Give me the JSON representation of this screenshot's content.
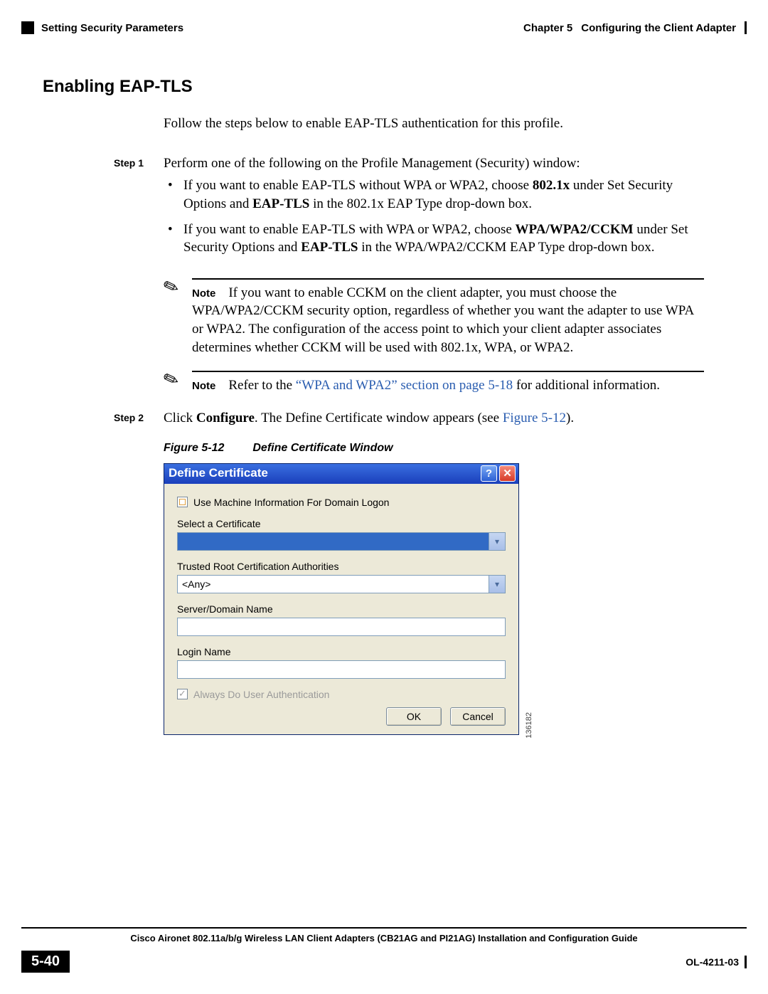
{
  "header": {
    "left": "Setting Security Parameters",
    "right_chapter": "Chapter 5",
    "right_title": "Configuring the Client Adapter"
  },
  "section_title": "Enabling EAP-TLS",
  "intro": "Follow the steps below to enable EAP-TLS authentication for this profile.",
  "steps": {
    "s1_label": "Step 1",
    "s1_text": "Perform one of the following on the Profile Management (Security) window:",
    "s1_b1_a": "If you want to enable EAP-TLS without WPA or WPA2, choose ",
    "s1_b1_bold1": "802.1x",
    "s1_b1_b": " under Set Security Options and ",
    "s1_b1_bold2": "EAP-TLS",
    "s1_b1_c": " in the 802.1x EAP Type drop-down box.",
    "s1_b2_a": "If you want to enable EAP-TLS with WPA or WPA2, choose ",
    "s1_b2_bold1": "WPA/WPA2/CCKM",
    "s1_b2_b": " under Set Security Options and ",
    "s1_b2_bold2": "EAP-TLS",
    "s1_b2_c": " in the WPA/WPA2/CCKM EAP Type drop-down box.",
    "s2_label": "Step 2",
    "s2_a": "Click ",
    "s2_bold": "Configure",
    "s2_b": ". The Define Certificate window appears (see ",
    "s2_link": "Figure 5-12",
    "s2_c": ")."
  },
  "notes": {
    "label": "Note",
    "n1": "If you want to enable CCKM on the client adapter, you must choose the WPA/WPA2/CCKM security option, regardless of whether you want the adapter to use WPA or WPA2. The configuration of the access point to which your client adapter associates determines whether CCKM will be used with 802.1x, WPA, or WPA2.",
    "n2_a": "Refer to the ",
    "n2_link": "“WPA and WPA2” section on page 5-18",
    "n2_b": " for additional information."
  },
  "figure": {
    "num": "Figure 5-12",
    "title": "Define Certificate Window",
    "image_id": "136182"
  },
  "dialog": {
    "title": "Define Certificate",
    "machine_info": "Use Machine Information For Domain Logon",
    "select_cert": "Select a Certificate",
    "cert_value": "",
    "trusted_root": "Trusted Root Certification Authorities",
    "trusted_value": "<Any>",
    "server_domain": "Server/Domain Name",
    "login_name": "Login Name",
    "always_auth": "Always Do User Authentication",
    "ok": "OK",
    "cancel": "Cancel"
  },
  "footer": {
    "guide": "Cisco Aironet 802.11a/b/g Wireless LAN Client Adapters (CB21AG and PI21AG) Installation and Configuration Guide",
    "page": "5-40",
    "doc": "OL-4211-03"
  }
}
